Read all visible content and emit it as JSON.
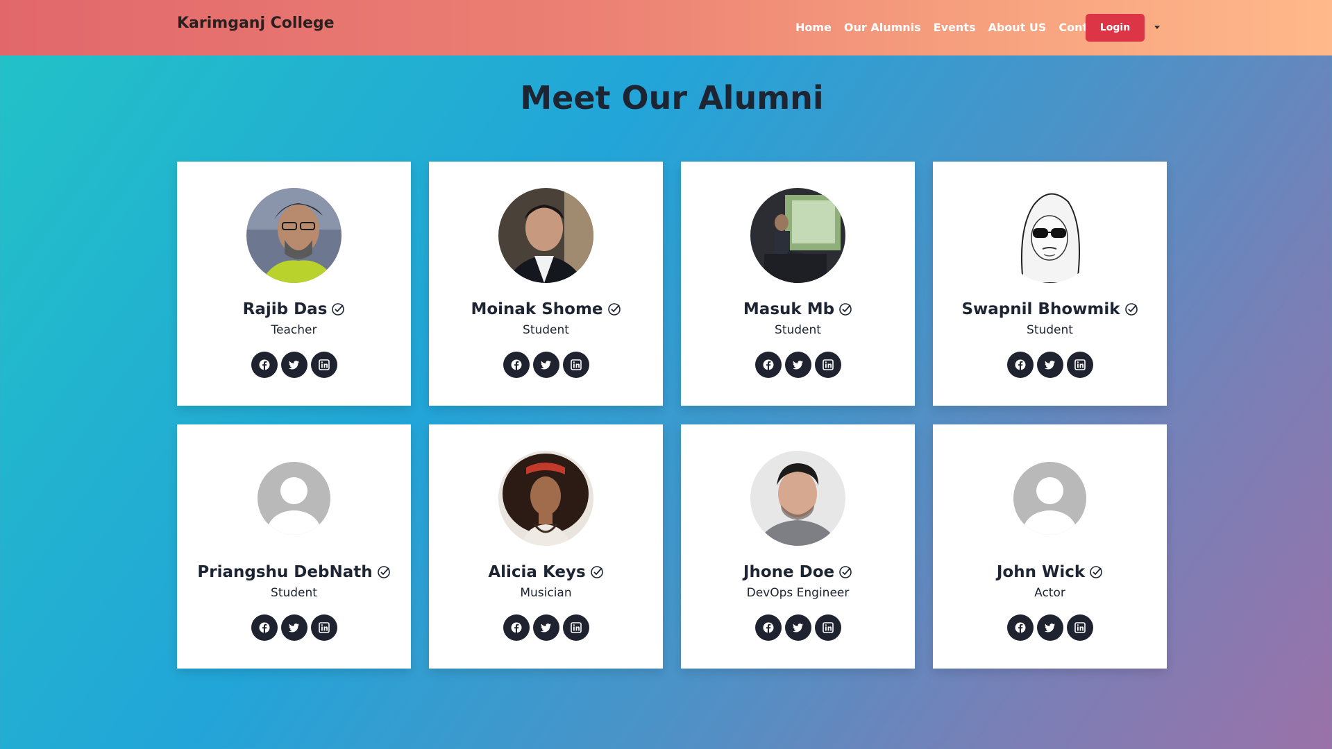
{
  "nav": {
    "brand": "Karimganj College",
    "links": [
      "Home",
      "Our Alumnis",
      "Events",
      "About US",
      "Contact"
    ],
    "login_label": "Login"
  },
  "page_title": "Meet Our Alumni",
  "alumni": [
    {
      "name": "Rajib Das",
      "role": "Teacher",
      "avatar": "photo-man-glasses-beard"
    },
    {
      "name": "Moinak Shome",
      "role": "Student",
      "avatar": "photo-man-suit"
    },
    {
      "name": "Masuk Mb",
      "role": "Student",
      "avatar": "photo-man-sitting-window"
    },
    {
      "name": "Swapnil Bhowmik",
      "role": "Student",
      "avatar": "sketch-hooded-sunglasses"
    },
    {
      "name": "Priangshu DebNath",
      "role": "Student",
      "avatar": "default-user-icon"
    },
    {
      "name": "Alicia Keys",
      "role": "Musician",
      "avatar": "photo-woman-curly-hair"
    },
    {
      "name": "Jhone Doe",
      "role": "DevOps Engineer",
      "avatar": "photo-man-dark-hair"
    },
    {
      "name": "John Wick",
      "role": "Actor",
      "avatar": "default-user-icon"
    }
  ],
  "colors": {
    "login_bg": "#dc3545",
    "social_bg": "#1f2330",
    "title_text": "#1d2533"
  },
  "icons": [
    "verified-check-icon",
    "facebook-icon",
    "twitter-icon",
    "linkedin-icon"
  ]
}
